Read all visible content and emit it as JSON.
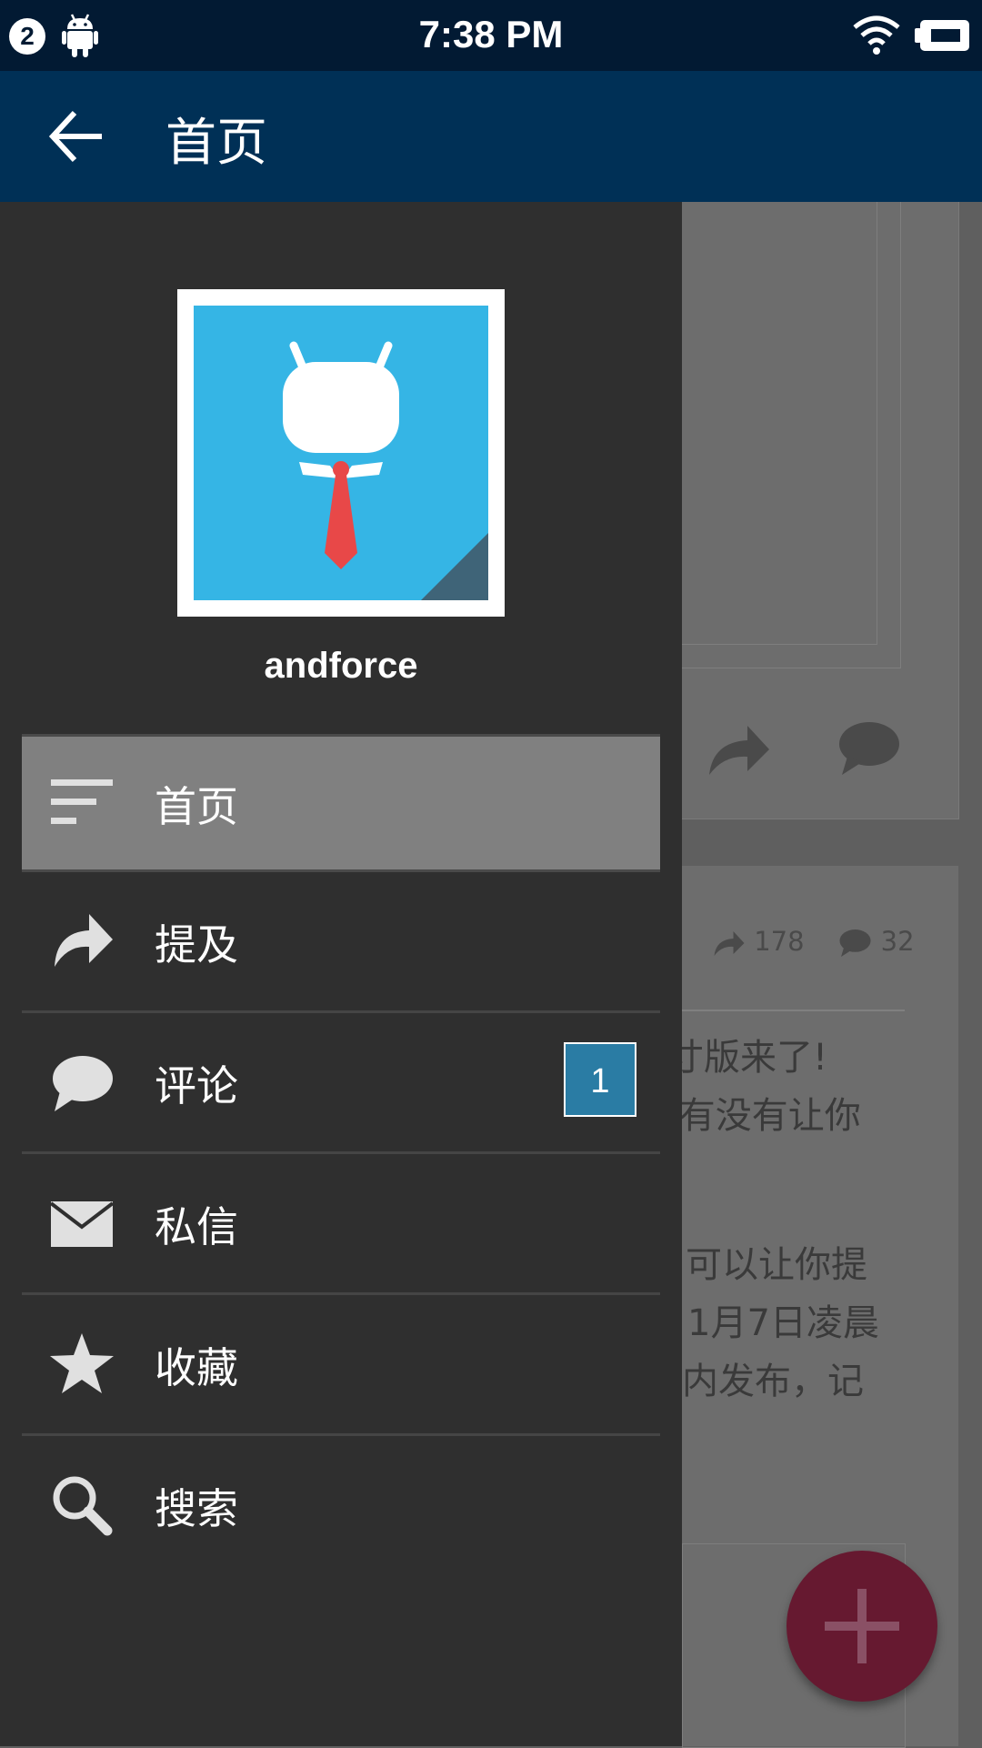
{
  "status_bar": {
    "notification_count": "2",
    "time": "7:38 PM",
    "icons": [
      "android-icon",
      "wifi-icon",
      "battery-icon"
    ]
  },
  "app_bar": {
    "title": "首页",
    "back_icon": "arrow-back-icon"
  },
  "drawer": {
    "username": "andforce",
    "avatar_icon": "android-robot-with-tie-avatar",
    "items": [
      {
        "label": "首页",
        "icon": "sort-lines-icon",
        "active": true
      },
      {
        "label": "提及",
        "icon": "share-arrow-icon"
      },
      {
        "label": "评论",
        "icon": "chat-bubble-icon",
        "badge": "1"
      },
      {
        "label": "私信",
        "icon": "envelope-icon"
      },
      {
        "label": "收藏",
        "icon": "star-icon"
      },
      {
        "label": "搜索",
        "icon": "search-icon"
      }
    ]
  },
  "background_feed": {
    "post": {
      "repost_count": "178",
      "comment_count": "32",
      "lines": [
        "寸版来了!",
        "”有没有让你",
        "可以让你提",
        "1月7日凌晨",
        "内发布，记"
      ]
    }
  },
  "fab": {
    "icon": "plus-icon"
  },
  "colors": {
    "status_bar": "#021a33",
    "app_bar": "#003056",
    "drawer_bg": "#2f2f2f",
    "active_item": "#808080",
    "badge": "#2a7ca4",
    "fab": "#661930",
    "avatar_bg": "#35b5e5"
  }
}
